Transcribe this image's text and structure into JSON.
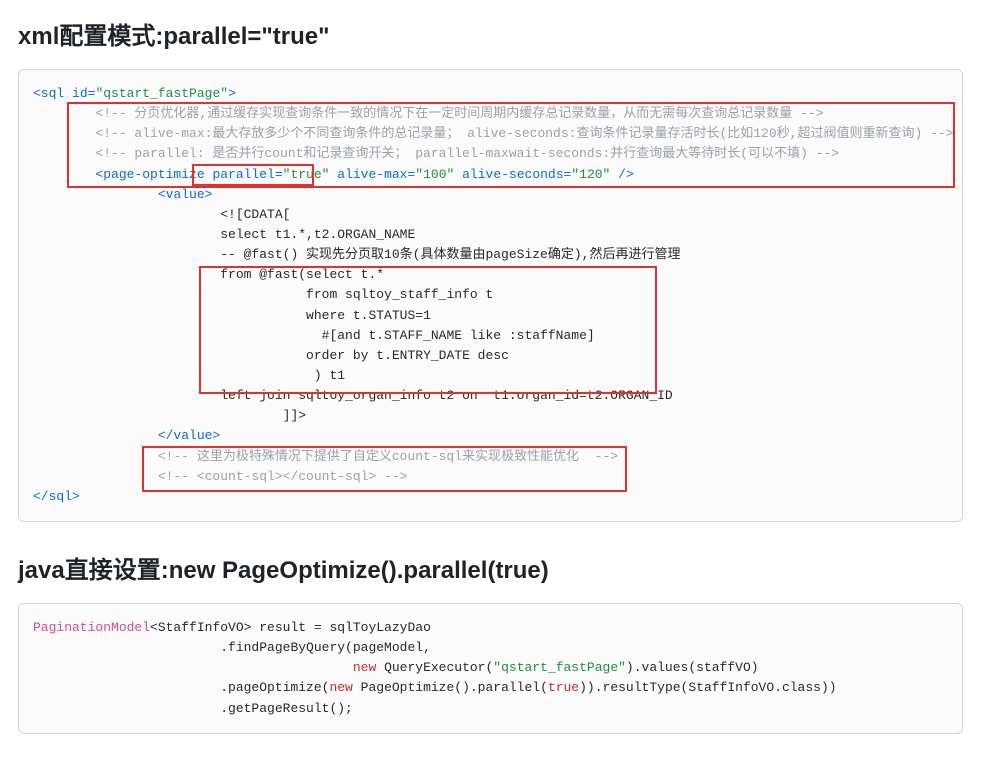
{
  "heading1": "xml配置模式:parallel=\"true\"",
  "heading2": "java直接设置:new PageOptimize().parallel(true)",
  "xml": {
    "l01a": "<sql",
    "l01b": " id=",
    "l01c": "\"qstart_fastPage\"",
    "l01d": ">",
    "l02": "        <!-- 分页优化器,通过缓存实现查询条件一致的情况下在一定时间周期内缓存总记录数量，从而无需每次查询总记录数量 -->",
    "l03": "        <!-- alive-max:最大存放多少个不同查询条件的总记录量； alive-seconds:查询条件记录量存活时长(比如120秒,超过阀值则重新查询) -->",
    "l04": "        <!-- parallel: 是否并行count和记录查询开关； parallel-maxwait-seconds:并行查询最大等待时长(可以不填) -->",
    "l05a": "        <page-optimize",
    "l05b": " parallel=",
    "l05c": "\"true\"",
    "l05d": " alive-max=",
    "l05e": "\"100\"",
    "l05f": " alive-seconds=",
    "l05g": "\"120\"",
    "l05h": " />",
    "l06a": "                <value>",
    "l07": "                        <![CDATA[",
    "l08": "                        select t1.*,t2.ORGAN_NAME",
    "l09": "                        -- @fast() 实现先分页取10条(具体数量由pageSize确定),然后再进行管理",
    "l10": "                        from @fast(select t.*",
    "l11": "                                   from sqltoy_staff_info t",
    "l12": "                                   where t.STATUS=1",
    "l13": "                                     #[and t.STAFF_NAME like :staffName]",
    "l14": "                                   order by t.ENTRY_DATE desc",
    "l15": "                                    ) t1",
    "l16": "                        left join sqltoy_organ_info t2 on  t1.organ_id=t2.ORGAN_ID",
    "l17": "                                ]]>",
    "l18": "                </value>",
    "l19": "                <!-- 这里为极特殊情况下提供了自定义count-sql来实现极致性能优化  -->",
    "l20": "                <!-- <count-sql></count-sql> -->",
    "l21": "</sql>"
  },
  "java": {
    "l1a": "PaginationModel",
    "l1b": "<StaffInfoVO> result = sqlToyLazyDao",
    "l2a": "                        .findPageByQuery(pageModel,",
    "l3a": "                                         ",
    "l3b": "new",
    "l3c": " QueryExecutor(",
    "l3d": "\"qstart_fastPage\"",
    "l3e": ").values(staffVO)",
    "l4a": "                        .pageOptimize(",
    "l4b": "new",
    "l4c": " PageOptimize().parallel(",
    "l4d": "true",
    "l4e": ")).resultType(StaffInfoVO.class))",
    "l5a": "                        .getPageResult();"
  }
}
